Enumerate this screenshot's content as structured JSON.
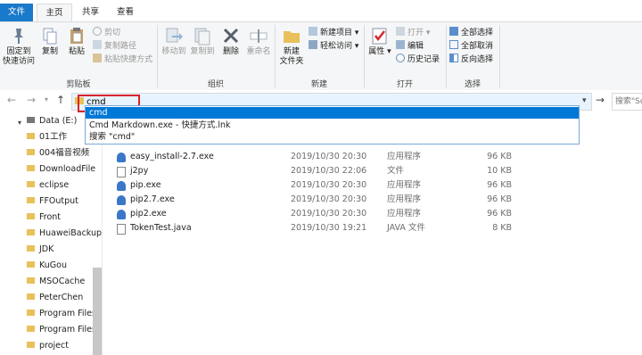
{
  "tabs": {
    "file": "文件",
    "home": "主页",
    "share": "共享",
    "view": "查看"
  },
  "ribbon": {
    "pin": "固定到\n快速访问",
    "copy": "复制",
    "paste": "粘贴",
    "cut": "剪切",
    "copy_path": "复制路径",
    "paste_shortcut": "粘贴快捷方式",
    "clipboard_group": "剪贴板",
    "move_to": "移动到",
    "copy_to": "复制到",
    "delete": "删除",
    "rename": "重命名",
    "organize_group": "组织",
    "new_folder": "新建\n文件夹",
    "new_item": "新建项目",
    "easy_access": "轻松访问",
    "new_group": "新建",
    "properties": "属性",
    "open": "打开",
    "edit": "编辑",
    "history": "历史记录",
    "open_group": "打开",
    "select_all": "全部选择",
    "select_none": "全部取消",
    "invert_selection": "反向选择",
    "select_group": "选择"
  },
  "address": {
    "value": "cmd",
    "search_placeholder": "搜索\"So"
  },
  "suggestions": [
    "cmd",
    "Cmd Markdown.exe - 快捷方式.lnk",
    "搜索 \"cmd\""
  ],
  "sidebar": {
    "drive": "Data (E:)",
    "folders": [
      "01工作",
      "004福音视频",
      "DownloadFile",
      "eclipse",
      "FFOutput",
      "Front",
      "HuaweiBackup",
      "JDK",
      "KuGou",
      "MSOCache",
      "PeterChen",
      "Program Files",
      "Program Files",
      "project"
    ]
  },
  "files": [
    {
      "name": "easy_install-2.7.exe",
      "date": "2019/10/30 20:30",
      "type": "应用程序",
      "size": "96 KB",
      "icon": "exe-icon"
    },
    {
      "name": "j2py",
      "date": "2019/10/30 22:06",
      "type": "文件",
      "size": "10 KB",
      "icon": "file-icon"
    },
    {
      "name": "pip.exe",
      "date": "2019/10/30 20:30",
      "type": "应用程序",
      "size": "96 KB",
      "icon": "exe-icon"
    },
    {
      "name": "pip2.7.exe",
      "date": "2019/10/30 20:30",
      "type": "应用程序",
      "size": "96 KB",
      "icon": "exe-icon"
    },
    {
      "name": "pip2.exe",
      "date": "2019/10/30 20:30",
      "type": "应用程序",
      "size": "96 KB",
      "icon": "exe-icon"
    },
    {
      "name": "TokenTest.java",
      "date": "2019/10/30 19:21",
      "type": "JAVA 文件",
      "size": "8 KB",
      "icon": "file-icon"
    }
  ]
}
